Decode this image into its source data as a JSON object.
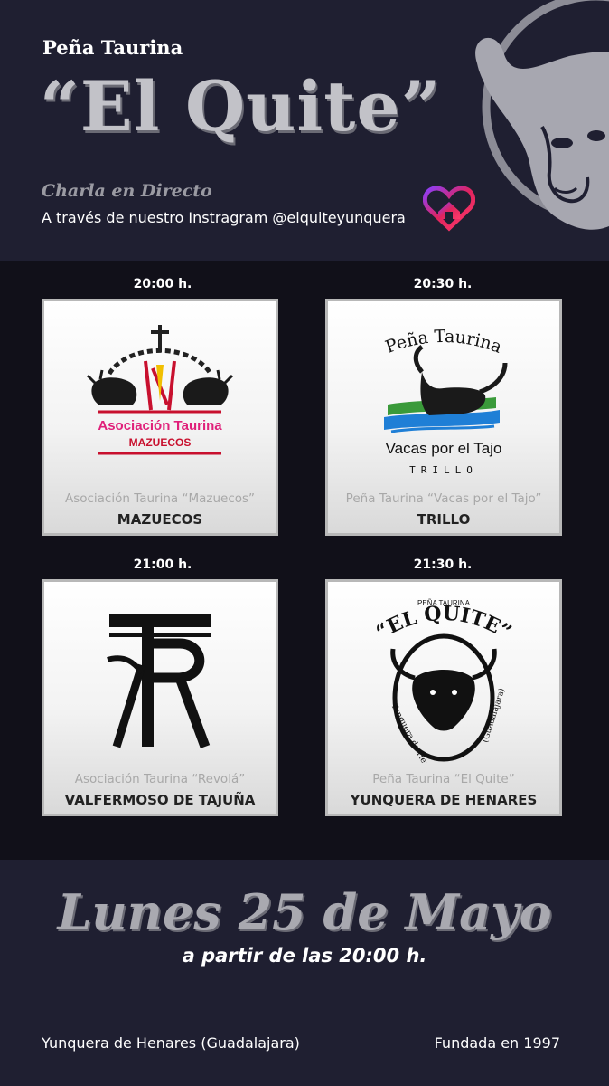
{
  "header": {
    "kicker": "Peña Taurina",
    "title": "“El Quite”",
    "talk": "Charla en Directo",
    "via": "A través de nuestro Instragram @elquiteyunquera"
  },
  "sessions": [
    {
      "time": "20:00 h.",
      "subtitle": "Asociación Taurina “Mazuecos”",
      "place": "MAZUECOS",
      "logo_text": [
        "Asociación Taurina",
        "MAZUECOS"
      ]
    },
    {
      "time": "20:30 h.",
      "subtitle": "Peña Taurina “Vacas por el Tajo”",
      "place": "TRILLO",
      "logo_text": [
        "Peña Taurina",
        "Vacas por el Tajo",
        "TRILLO"
      ]
    },
    {
      "time": "21:00 h.",
      "subtitle": "Asociación Taurina “Revolá”",
      "place": "VALFERMOSO DE TAJUÑA",
      "logo_text": []
    },
    {
      "time": "21:30 h.",
      "subtitle": "Peña Taurina “El Quite”",
      "place": "YUNQUERA DE HENARES",
      "logo_text": [
        "PEÑA TAURINA",
        "“EL QUITE”",
        "Yunquera de Henares",
        "(Guadalajara)"
      ]
    }
  ],
  "footer": {
    "date": "Lunes 25 de Mayo",
    "from": "a partir de las 20:00 h.",
    "location": "Yunquera de Henares (Guadalajara)",
    "founded": "Fundada en 1997"
  },
  "colors": {
    "header_bg": "#1f1f31",
    "main_bg": "#111019",
    "title_silver": "#c2c2c8",
    "mazuecos_pink": "#e0207a",
    "mazuecos_red": "#c8102e",
    "spain_yellow": "#f1bf00",
    "tajo_green": "#3a9a3a",
    "tajo_blue": "#1f7fd6"
  }
}
